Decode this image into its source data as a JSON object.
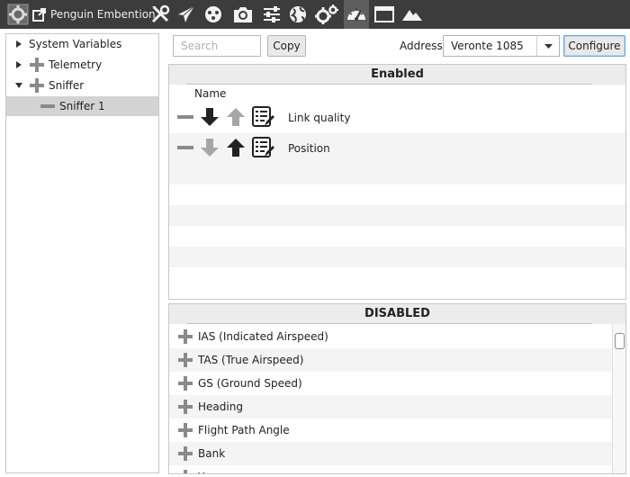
{
  "app": {
    "title": "Penguin Embention",
    "toolbar": [
      {
        "icon": "settings-icon",
        "active": false
      },
      {
        "icon": "external-link-icon",
        "active": false
      },
      {
        "icon": "tools-icon",
        "active": false
      },
      {
        "icon": "airplane-icon",
        "active": false
      },
      {
        "icon": "joystick-icon",
        "active": false
      },
      {
        "icon": "camera-icon",
        "active": false
      },
      {
        "icon": "sliders-icon",
        "active": false
      },
      {
        "icon": "globe-icon",
        "active": false
      },
      {
        "icon": "gears-icon",
        "active": false
      },
      {
        "icon": "gauge-icon",
        "active": true
      },
      {
        "icon": "window-icon",
        "active": false
      },
      {
        "icon": "terrain-icon",
        "active": false
      }
    ]
  },
  "tree": {
    "items": [
      {
        "label": "System Variables",
        "expander": "collapsed",
        "icon": null,
        "selected": false
      },
      {
        "label": "Telemetry",
        "expander": "collapsed",
        "icon": "plus-icon",
        "selected": false
      },
      {
        "label": "Sniffer",
        "expander": "expanded",
        "icon": "plus-icon",
        "selected": false
      },
      {
        "label": "Sniffer 1",
        "expander": null,
        "icon": "minus-icon",
        "selected": true
      }
    ]
  },
  "header": {
    "search_placeholder": "Search",
    "copy_label": "Copy",
    "address_label": "Address",
    "address_value": "Veronte 1085",
    "configure_label": "Configure"
  },
  "enabled": {
    "title": "Enabled",
    "column_name": "Name",
    "rows": [
      {
        "label": "Link quality",
        "down_active": true,
        "up_active": false
      },
      {
        "label": "Position",
        "down_active": false,
        "up_active": true
      }
    ]
  },
  "disabled": {
    "title": "DISABLED",
    "rows": [
      {
        "label": "IAS (Indicated Airspeed)"
      },
      {
        "label": "TAS (True Airspeed)"
      },
      {
        "label": "GS (Ground Speed)"
      },
      {
        "label": "Heading"
      },
      {
        "label": "Flight Path Angle"
      },
      {
        "label": "Bank"
      },
      {
        "label": "Yaw"
      }
    ]
  },
  "colors": {
    "toolbar_bg": "#3c3c3c",
    "toolbar_active": "#5e5e5e",
    "icon_gray": "#8a8a8a",
    "arrow_dark": "#222222",
    "arrow_light": "#a6a6a6",
    "selection": "#d3d3d3"
  }
}
